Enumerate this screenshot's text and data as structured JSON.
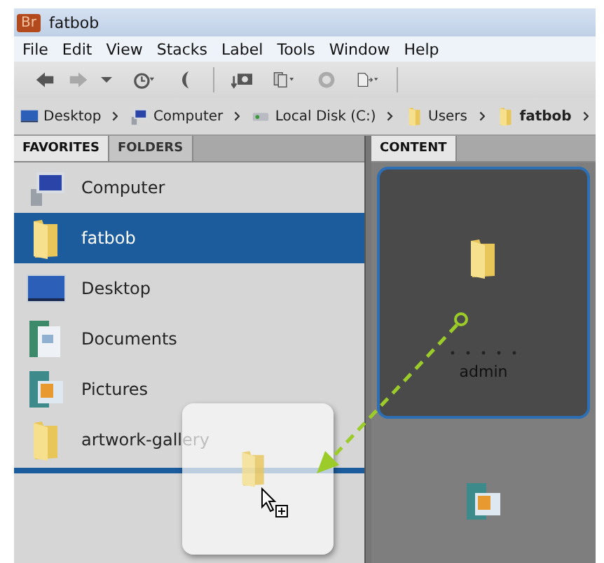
{
  "window": {
    "app_badge": "Br",
    "title": "fatbob"
  },
  "menu": [
    "File",
    "Edit",
    "View",
    "Stacks",
    "Label",
    "Tools",
    "Window",
    "Help"
  ],
  "breadcrumb": [
    {
      "label": "Desktop",
      "kind": "desktop",
      "bold": false
    },
    {
      "label": "Computer",
      "kind": "computer",
      "bold": false
    },
    {
      "label": "Local Disk (C:)",
      "kind": "disk",
      "bold": false
    },
    {
      "label": "Users",
      "kind": "folder",
      "bold": false
    },
    {
      "label": "fatbob",
      "kind": "folder",
      "bold": true
    }
  ],
  "left_panel": {
    "tabs": [
      {
        "label": "FAVORITES",
        "selected": true
      },
      {
        "label": "FOLDERS",
        "selected": false
      }
    ],
    "items": [
      {
        "label": "Computer",
        "kind": "computer",
        "selected": false
      },
      {
        "label": "fatbob",
        "kind": "folder",
        "selected": true
      },
      {
        "label": "Desktop",
        "kind": "desktop",
        "selected": false
      },
      {
        "label": "Documents",
        "kind": "documents",
        "selected": false
      },
      {
        "label": "Pictures",
        "kind": "pictures",
        "selected": false
      },
      {
        "label": "artwork-gallery",
        "kind": "folder",
        "selected": false
      }
    ]
  },
  "content_panel": {
    "tabs": [
      {
        "label": "CONTENT",
        "selected": true
      }
    ],
    "items": [
      {
        "kind": "folder",
        "name": "admin",
        "stars": 0,
        "selected": true
      },
      {
        "kind": "pictures",
        "selected": false
      }
    ]
  }
}
